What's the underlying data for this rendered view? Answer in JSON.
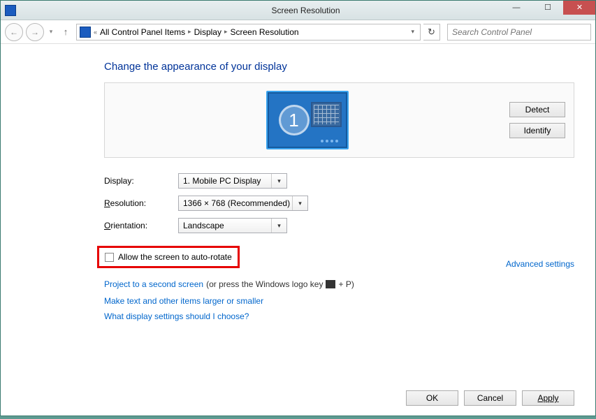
{
  "titlebar": {
    "title": "Screen Resolution"
  },
  "breadcrumb": {
    "items": [
      "All Control Panel Items",
      "Display",
      "Screen Resolution"
    ]
  },
  "search": {
    "placeholder": "Search Control Panel"
  },
  "heading": "Change the appearance of your display",
  "preview": {
    "detect": "Detect",
    "identify": "Identify",
    "monitor_number": "1"
  },
  "form": {
    "display_label": "Display:",
    "display_value": "1. Mobile PC Display",
    "resolution_label_pre": "R",
    "resolution_label_post": "esolution:",
    "resolution_value": "1366 × 768 (Recommended)",
    "orientation_label_pre": "O",
    "orientation_label_post": "rientation:",
    "orientation_value": "Landscape"
  },
  "checkbox": {
    "label": "Allow the screen to auto-rotate"
  },
  "advanced": "Advanced settings",
  "project": {
    "link": "Project to a second screen",
    "hint_pre": " (or press the Windows logo key ",
    "hint_post": " + P)"
  },
  "sublinks": {
    "text_size": "Make text and other items larger or smaller",
    "help": "What display settings should I choose?"
  },
  "footer": {
    "ok": "OK",
    "cancel": "Cancel",
    "apply": "Apply"
  }
}
